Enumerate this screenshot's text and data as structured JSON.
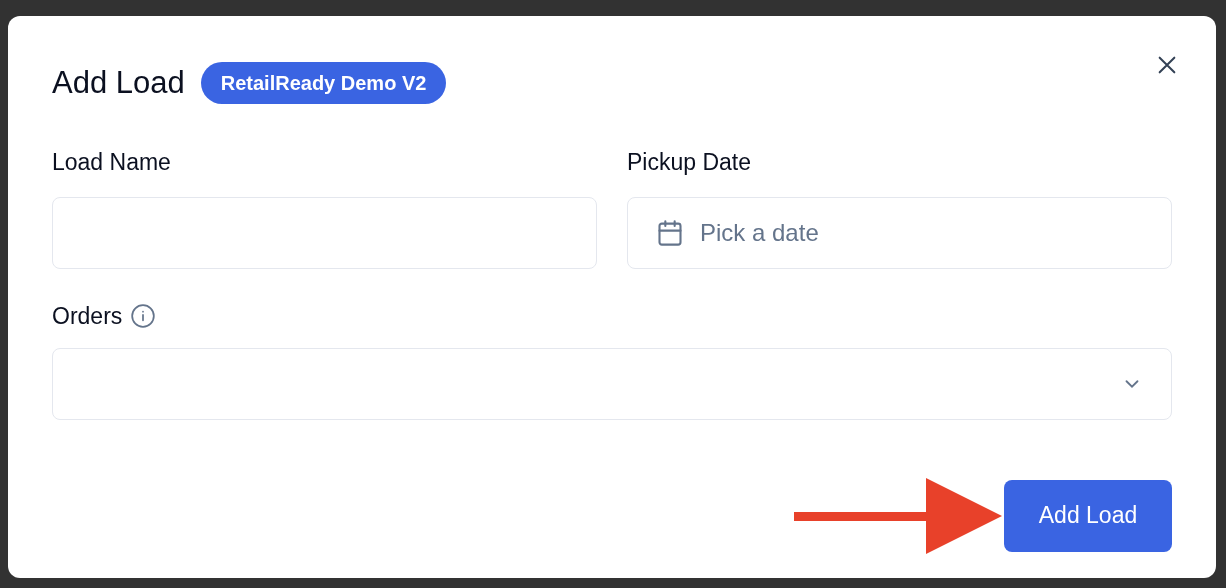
{
  "dialog": {
    "title": "Add Load",
    "badge": "RetailReady Demo V2"
  },
  "fields": [
    {
      "label": "Load Name",
      "kind": "text"
    },
    {
      "label": "Pickup Date",
      "kind": "date",
      "placeholder": "Pick a date"
    }
  ],
  "orders": {
    "label": "Orders"
  },
  "submit": "Add Load"
}
